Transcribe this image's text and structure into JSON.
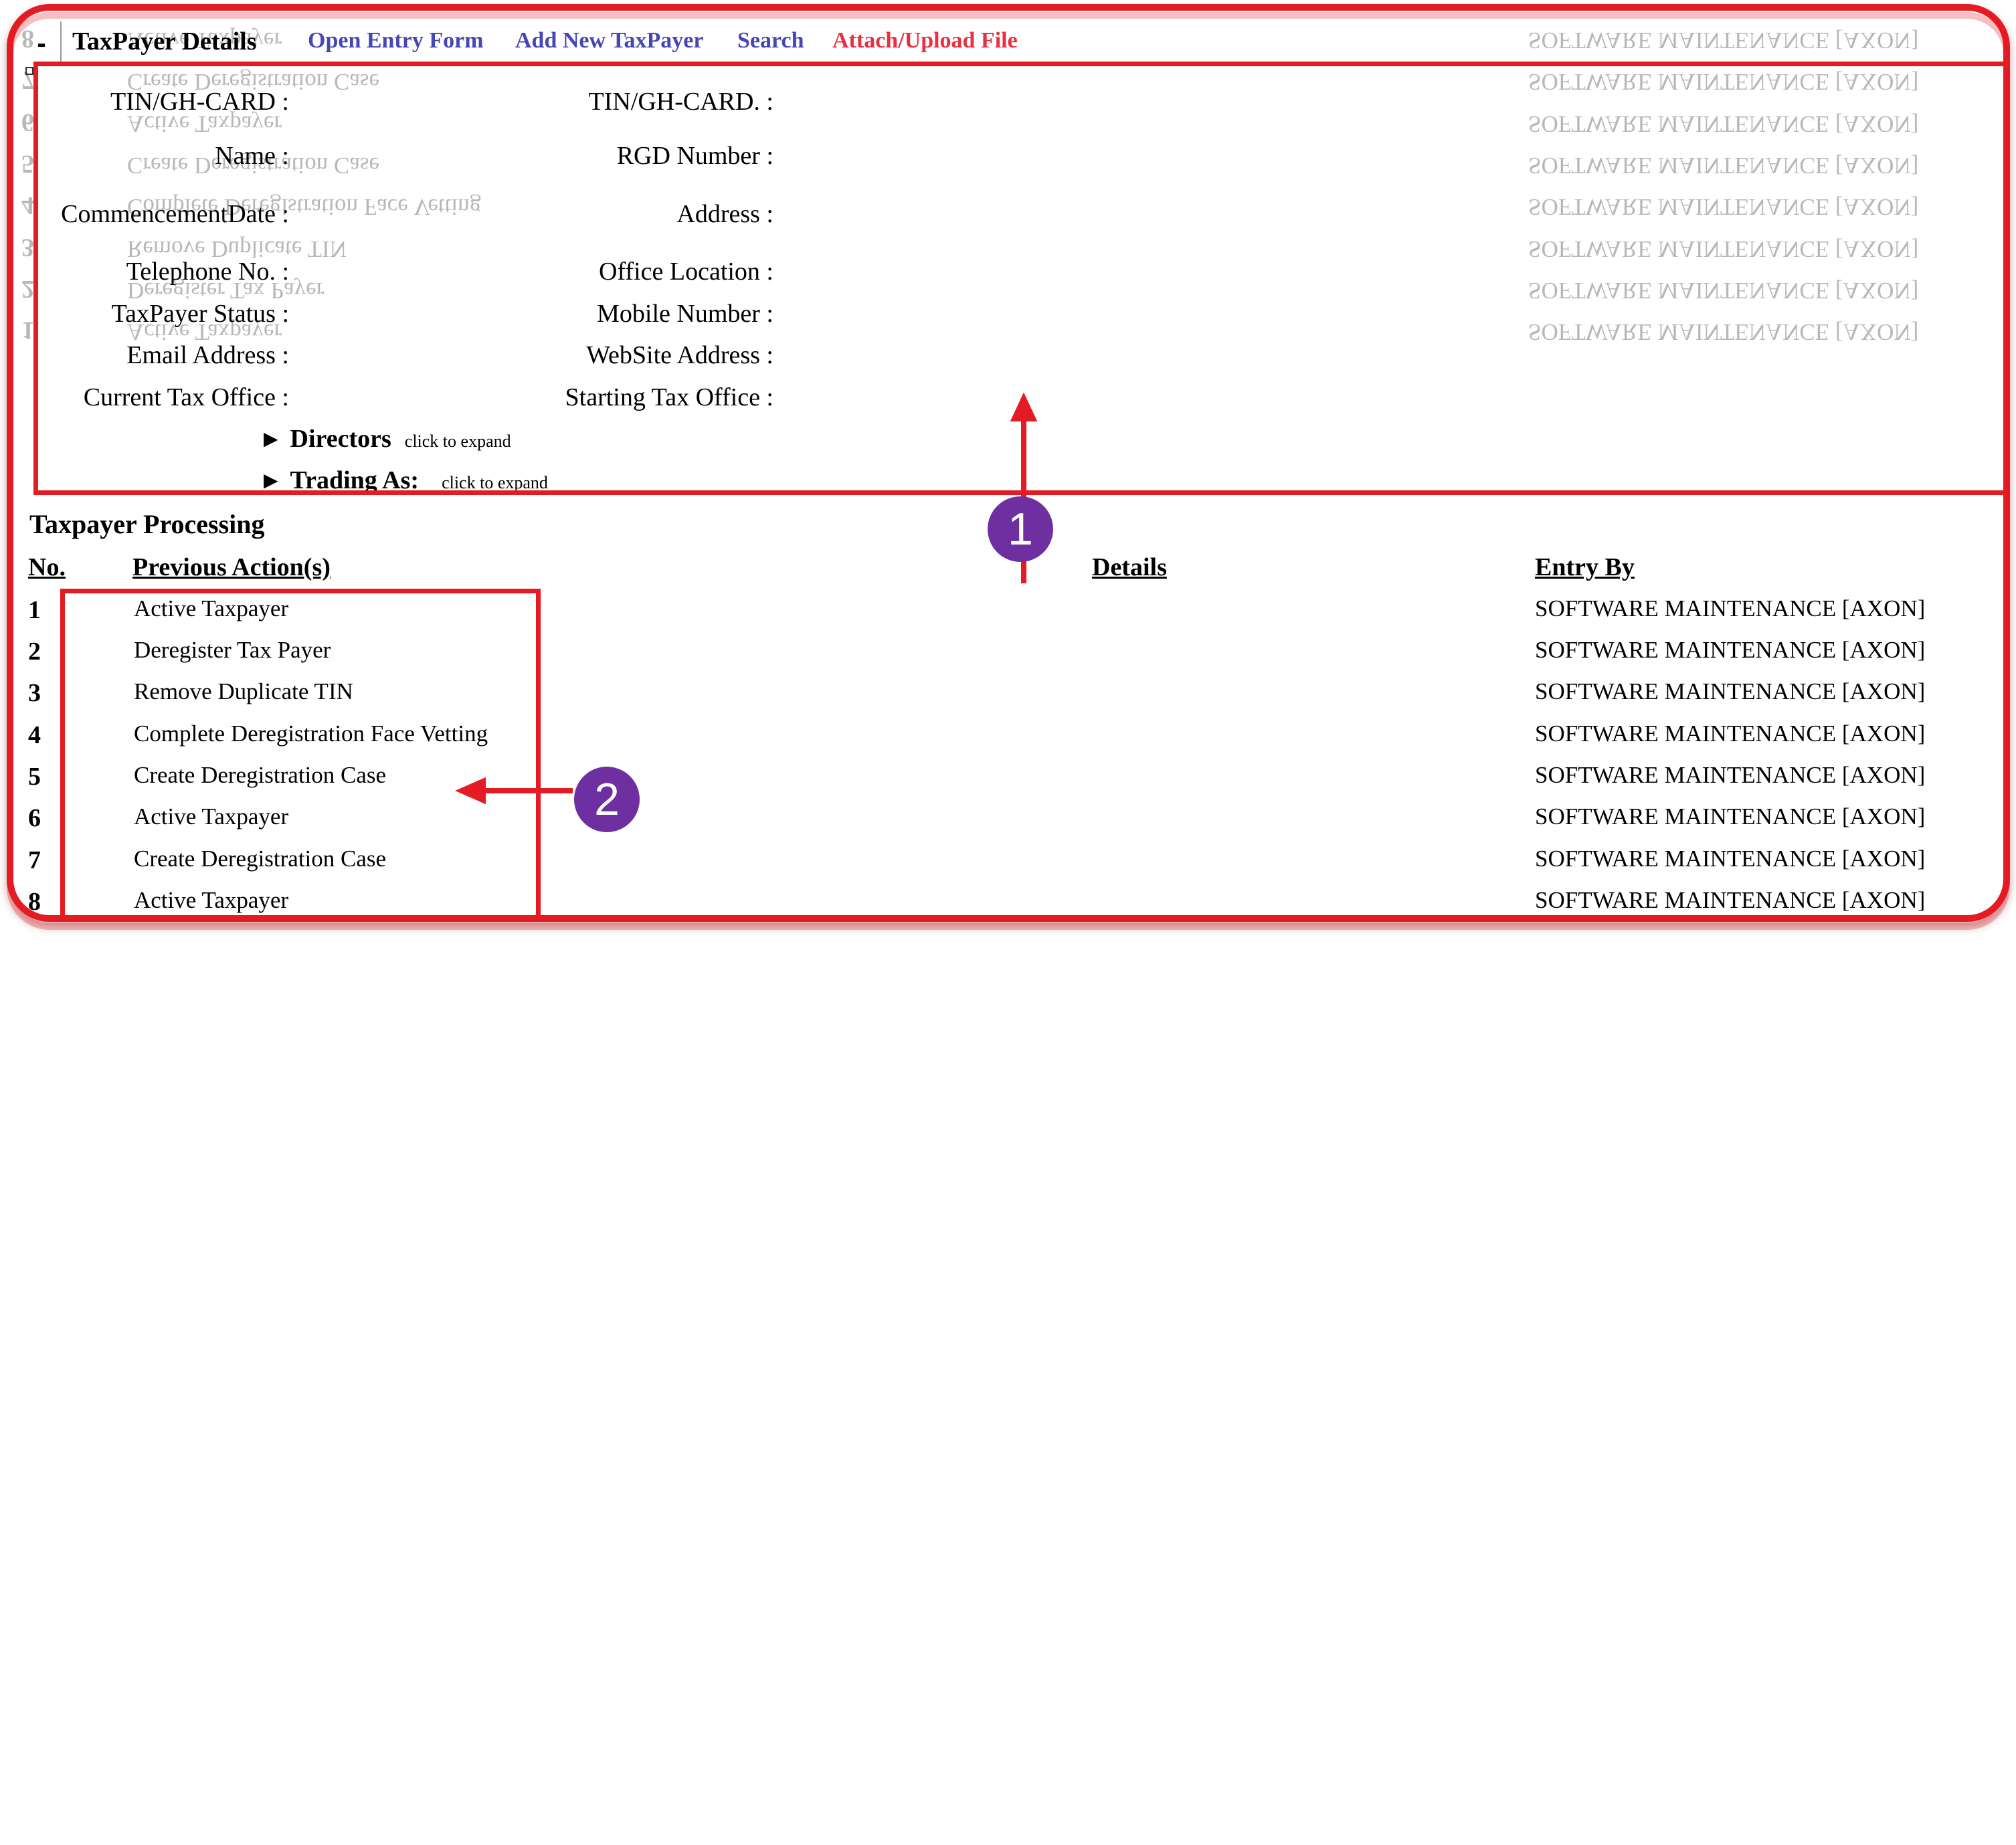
{
  "header": {
    "collapse_symbol": "-",
    "title": "TaxPayer Details",
    "links": {
      "open_entry_form": "Open Entry Form",
      "add_new_taxpayer": "Add New TaxPayer",
      "search": "Search",
      "attach_upload": "Attach/Upload File"
    }
  },
  "details": {
    "left_labels": [
      "TIN/GH-CARD :",
      "Name :",
      "CommencementDate :",
      "Telephone No. :",
      "TaxPayer Status :",
      "Email Address :",
      "Current Tax Office :"
    ],
    "right_labels": [
      "TIN/GH-CARD. :",
      "RGD Number :",
      "Address :",
      "Office Location :",
      "Mobile Number :",
      "WebSite Address :",
      "Starting Tax Office :"
    ],
    "expanders": [
      {
        "label": "Directors",
        "hint": "click to expand"
      },
      {
        "label": "Trading As:",
        "hint": "click to expand"
      }
    ]
  },
  "processing": {
    "title": "Taxpayer Processing",
    "columns": {
      "no": "No.",
      "action": "Previous Action(s)",
      "details": "Details",
      "entry_by": "Entry By"
    },
    "rows": [
      {
        "no": "1",
        "action": "Active Taxpayer",
        "details": "",
        "entry_by": "SOFTWARE MAINTENANCE [AXON]"
      },
      {
        "no": "2",
        "action": "Deregister Tax Payer",
        "details": "",
        "entry_by": "SOFTWARE MAINTENANCE [AXON]"
      },
      {
        "no": "3",
        "action": "Remove Duplicate TIN",
        "details": "",
        "entry_by": "SOFTWARE MAINTENANCE [AXON]"
      },
      {
        "no": "4",
        "action": "Complete Deregistration Face Vetting",
        "details": "",
        "entry_by": "SOFTWARE MAINTENANCE [AXON]"
      },
      {
        "no": "5",
        "action": "Create Deregistration Case",
        "details": "",
        "entry_by": "SOFTWARE MAINTENANCE [AXON]"
      },
      {
        "no": "6",
        "action": "Active Taxpayer",
        "details": "",
        "entry_by": "SOFTWARE MAINTENANCE [AXON]"
      },
      {
        "no": "7",
        "action": "Create Deregistration Case",
        "details": "",
        "entry_by": "SOFTWARE MAINTENANCE [AXON]"
      },
      {
        "no": "8",
        "action": "Active Taxpayer",
        "details": "",
        "entry_by": "SOFTWARE MAINTENANCE [AXON]"
      }
    ]
  },
  "annotations": {
    "callout_1": "1",
    "callout_2": "2",
    "color": "#e41b23",
    "callout_color": "#6e2fa0"
  },
  "colors": {
    "link": "#4646b4",
    "attach_link": "#e83040",
    "frame": "#e41b23"
  }
}
